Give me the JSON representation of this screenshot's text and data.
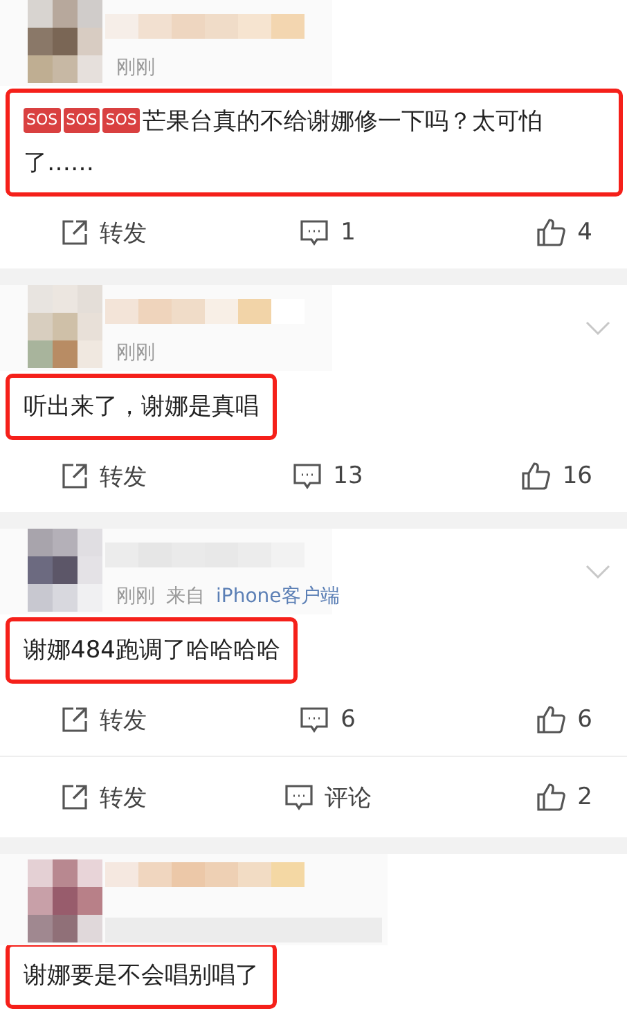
{
  "posts": [
    {
      "time": "刚刚",
      "comment": {
        "badges": [
          "SOS",
          "SOS",
          "SOS"
        ],
        "text": "芒果台真的不给谢娜修一下吗？太可怕了……",
        "highlighted": true,
        "full_width": true
      },
      "actions": {
        "share": "转发",
        "comments": "1",
        "likes": "4"
      }
    },
    {
      "time": "刚刚",
      "menu": true,
      "comment": {
        "text": "听出来了，谢娜是真唱",
        "highlighted": true,
        "full_width": false
      },
      "actions": {
        "share": "转发",
        "comments": "13",
        "likes": "16"
      }
    },
    {
      "time": "刚刚",
      "source_prefix": "来自",
      "source": "iPhone客户端",
      "menu": true,
      "comment": {
        "text": "谢娜484跑调了哈哈哈哈",
        "highlighted": true,
        "full_width": false
      },
      "actions": {
        "share": "转发",
        "comments": "6",
        "likes": "6"
      }
    }
  ],
  "extra_actions": {
    "share": "转发",
    "comments": "评论",
    "likes": "2"
  },
  "last_post": {
    "comment": {
      "text": "谢娜要是不会唱别唱了",
      "highlighted": true,
      "full_width": false
    }
  }
}
